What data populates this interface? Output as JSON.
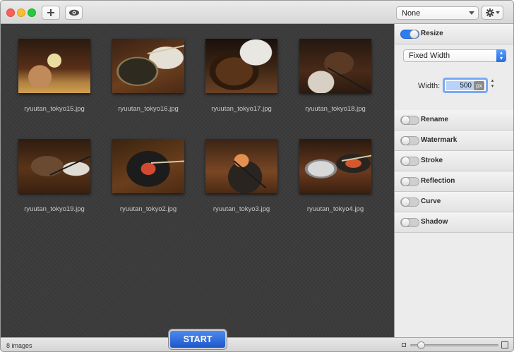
{
  "toolbar": {
    "preset_select": "None",
    "add_icon": "plus-icon",
    "preview_icon": "eye-icon",
    "settings_icon": "gear-icon"
  },
  "gallery": {
    "items": [
      {
        "filename": "ryuutan_tokyo15.jpg"
      },
      {
        "filename": "ryuutan_tokyo16.jpg"
      },
      {
        "filename": "ryuutan_tokyo17.jpg"
      },
      {
        "filename": "ryuutan_tokyo18.jpg"
      },
      {
        "filename": "ryuutan_tokyo19.jpg"
      },
      {
        "filename": "ryuutan_tokyo2.jpg"
      },
      {
        "filename": "ryuutan_tokyo3.jpg"
      },
      {
        "filename": "ryuutan_tokyo4.jpg"
      }
    ]
  },
  "sidebar": {
    "resize": {
      "label": "Resize",
      "enabled": true,
      "mode": "Fixed Width",
      "width_label": "Width:",
      "width_value": "500",
      "unit": "px"
    },
    "actions": [
      {
        "label": "Rename",
        "enabled": false
      },
      {
        "label": "Watermark",
        "enabled": false
      },
      {
        "label": "Stroke",
        "enabled": false
      },
      {
        "label": "Reflection",
        "enabled": false
      },
      {
        "label": "Curve",
        "enabled": false
      },
      {
        "label": "Shadow",
        "enabled": false
      }
    ]
  },
  "status": {
    "count": "8 images",
    "start_label": "START"
  },
  "colors": {
    "accent": "#2f7bf0",
    "start_button": "#1e56c8",
    "gallery_bg": "#3c3c3c"
  }
}
